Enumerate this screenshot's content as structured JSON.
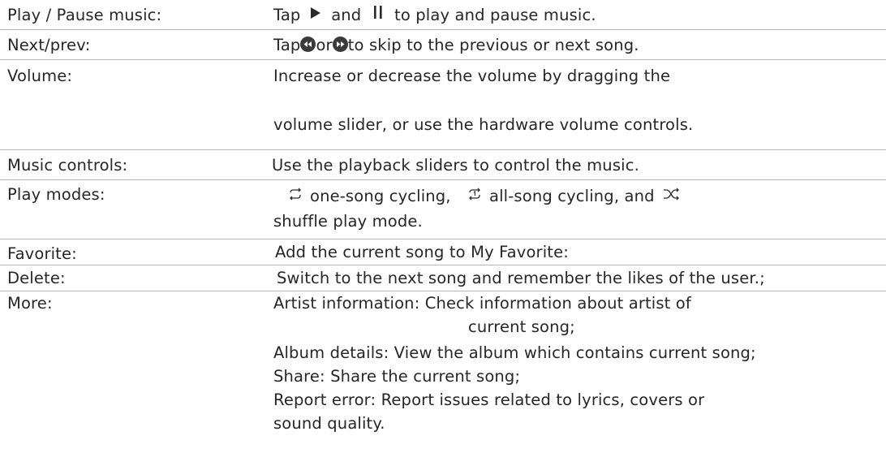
{
  "rows": [
    {
      "label": "Play / Pause music:",
      "text_prefix": "Tap",
      "text_and": "and",
      "text_suffix": "to play and pause music.",
      "icons": [
        "play-icon",
        "pause-icon"
      ]
    },
    {
      "label": "Next/prev:",
      "text_prefix": "Tap",
      "text_or": "or",
      "text_suffix": "to skip to the previous or next song.",
      "icons": [
        "previous-icon",
        "next-icon"
      ]
    },
    {
      "label": "Volume:",
      "line1": "Increase or decrease the volume by dragging the",
      "line2": "volume slider, or use the hardware volume controls."
    },
    {
      "label": "Music controls:",
      "text": "Use the playback sliders to control the music."
    },
    {
      "label": "Play modes:",
      "seg1": "one-song cycling,",
      "seg2": "all-song cycling, and",
      "line2": "shuffle play mode.",
      "icons": [
        "repeat-one-icon",
        "repeat-all-icon",
        "shuffle-icon"
      ]
    },
    {
      "label": "Favorite:",
      "text": "Add the current song to My Favorite:"
    },
    {
      "label": "Delete:",
      "text": "Switch to the next song and remember the likes of the user.;"
    },
    {
      "label": "More:",
      "line1": "Artist information: Check information about artist of",
      "line2": "current song;",
      "line3": "Album details: View the album which contains current song;",
      "line4": "Share: Share the current song;",
      "line5": "Report error: Report issues related to lyrics, covers or",
      "line6": "sound quality."
    }
  ],
  "colors": {
    "text": "#262626",
    "divider": "#b8b8b8",
    "icon_dark": "#3a3a3a"
  }
}
